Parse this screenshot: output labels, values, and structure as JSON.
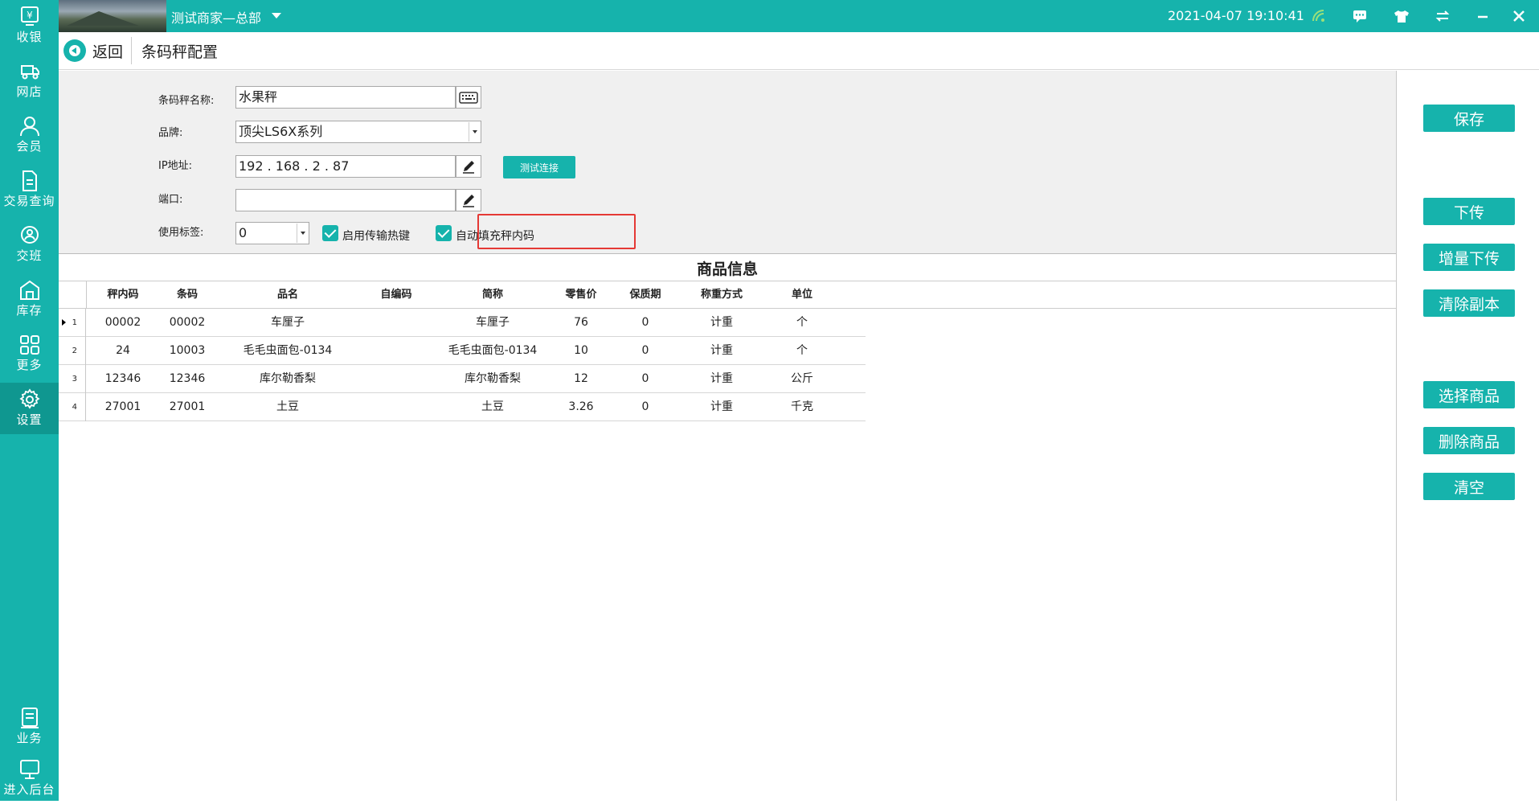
{
  "sidebar": {
    "items": [
      {
        "label": "收银",
        "icon": "cashier-icon"
      },
      {
        "label": "网店",
        "icon": "online-store-icon"
      },
      {
        "label": "会员",
        "icon": "member-icon"
      },
      {
        "label": "交易查询",
        "icon": "transaction-query-icon"
      },
      {
        "label": "交班",
        "icon": "shift-handover-icon"
      },
      {
        "label": "库存",
        "icon": "inventory-icon"
      },
      {
        "label": "更多",
        "icon": "more-icon"
      },
      {
        "label": "设置",
        "icon": "settings-icon"
      },
      {
        "label": "业务",
        "icon": "business-icon"
      },
      {
        "label": "进入后台",
        "icon": "backend-icon"
      }
    ],
    "active": "设置"
  },
  "topbar": {
    "merchant": "测试商家—总部",
    "datetime": "2021-04-07 19:10:41",
    "icons": [
      "wifi-icon",
      "message-icon",
      "theme-icon",
      "switch-icon",
      "minimize-icon",
      "close-icon"
    ]
  },
  "header": {
    "back_label": "返回",
    "title": "条码秤配置"
  },
  "form": {
    "name_label": "条码秤名称:",
    "name_value": "水果秤",
    "brand_label": "品牌:",
    "brand_value": "顶尖LS6X系列",
    "ip_label": "IP地址:",
    "ip_value": "192 . 168 . 2 . 87",
    "port_label": "端口:",
    "port_value": "",
    "test_button": "测试连接",
    "label_label": "使用标签:",
    "label_value": "0",
    "hotkey_checkbox": "启用传输热键",
    "hotkey_checked": true,
    "autofill_checkbox": "自动填充秤内码",
    "autofill_checked": true
  },
  "actions": {
    "save": "保存",
    "download": "下传",
    "incremental_download": "增量下传",
    "clear_copy": "清除副本",
    "select_goods": "选择商品",
    "delete_goods": "删除商品",
    "clear": "清空"
  },
  "table": {
    "title": "商品信息",
    "columns": [
      "秤内码",
      "条码",
      "品名",
      "自编码",
      "简称",
      "零售价",
      "保质期",
      "称重方式",
      "单位"
    ],
    "rows": [
      {
        "num": "1",
        "code": "00002",
        "barcode": "00002",
        "name": "车厘子",
        "selfcode": "",
        "short": "车厘子",
        "price": "76",
        "shelf": "0",
        "weigh": "计重",
        "unit": "个"
      },
      {
        "num": "2",
        "code": "24",
        "barcode": "10003",
        "name": "毛毛虫面包-0134",
        "selfcode": "",
        "short": "毛毛虫面包-0134",
        "price": "10",
        "shelf": "0",
        "weigh": "计重",
        "unit": "个"
      },
      {
        "num": "3",
        "code": "12346",
        "barcode": "12346",
        "name": "库尔勒香梨",
        "selfcode": "",
        "short": "库尔勒香梨",
        "price": "12",
        "shelf": "0",
        "weigh": "计重",
        "unit": "公斤"
      },
      {
        "num": "4",
        "code": "27001",
        "barcode": "27001",
        "name": "土豆",
        "selfcode": "",
        "short": "土豆",
        "price": "3.26",
        "shelf": "0",
        "weigh": "计重",
        "unit": "千克"
      }
    ]
  },
  "colors": {
    "accent": "#16b3ac",
    "highlight": "#e53935"
  }
}
